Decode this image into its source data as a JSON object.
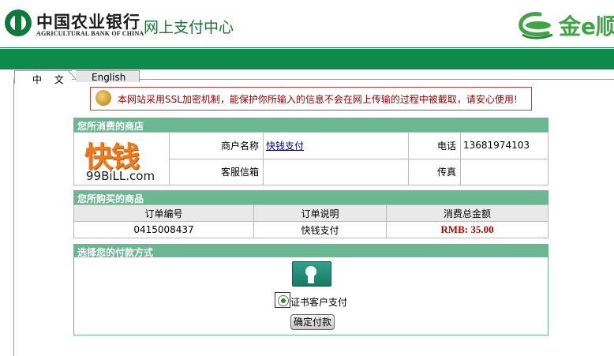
{
  "header": {
    "bank_name_cn": "中国农业银行",
    "bank_name_en": "AGRICULTURAL BANK OF CHINA",
    "page_title": "网上支付中心",
    "brand_name": "金e顺"
  },
  "tabs": {
    "chinese": "中 文",
    "english": "English"
  },
  "notice": "本网站采用SSL加密机制，能保护你所输入的信息不会在网上传输的过程中被截取，请安心使用!",
  "merchant": {
    "section_title": "您所消费的商店",
    "logo_text_top": "快钱",
    "logo_text_bottom": "99BiLL.com",
    "name_label": "商户名称",
    "name_value": "快钱支付",
    "phone_label": "电话",
    "phone_value": "13681974103",
    "email_label": "客服信箱",
    "email_value": "",
    "fax_label": "传真",
    "fax_value": ""
  },
  "goods": {
    "section_title": "您所购买的商品",
    "columns": [
      "订单编号",
      "订单说明",
      "消费总金额"
    ],
    "order_no": "0415008437",
    "description": "快钱支付",
    "amount": "RMB: 35.00"
  },
  "payment": {
    "section_title": "选择您的付款方式",
    "method_label": "证书客户支付",
    "method_selected": true,
    "confirm_label": "确定付款"
  },
  "colors": {
    "brand_green": "#0e8a4a",
    "panel_green": "#6ab891",
    "notice_red": "#9b0000",
    "price_red": "#c00000"
  }
}
